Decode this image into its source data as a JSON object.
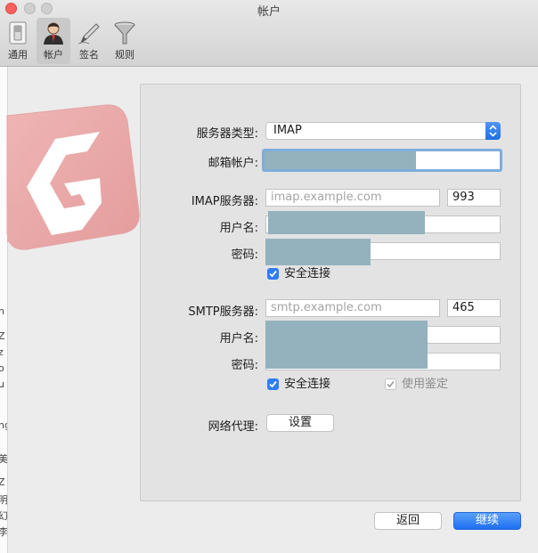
{
  "window": {
    "title": "帐户"
  },
  "toolbar": {
    "items": [
      {
        "label": "通用",
        "icon": "switch-icon"
      },
      {
        "label": "帐户",
        "icon": "user-icon",
        "active": true
      },
      {
        "label": "签名",
        "icon": "pen-icon"
      },
      {
        "label": "规则",
        "icon": "funnel-icon"
      }
    ]
  },
  "background_strip": {
    "fragments": [
      "h",
      "Z",
      "z",
      "o",
      "u",
      "ng",
      "美",
      "Z",
      "明",
      "幻",
      "李"
    ]
  },
  "form": {
    "server_type_label": "服务器类型:",
    "server_type_value": "IMAP",
    "email_label": "邮箱帐户:",
    "imap": {
      "server_label": "IMAP服务器:",
      "server_placeholder": "imap.example.com",
      "port": "993",
      "username_label": "用户名:",
      "password_label": "密码:",
      "ssl_label": "安全连接"
    },
    "smtp": {
      "server_label": "SMTP服务器:",
      "server_placeholder": "smtp.example.com",
      "port": "465",
      "username_label": "用户名:",
      "password_label": "密码:",
      "ssl_label": "安全连接",
      "auth_label": "使用鉴定"
    },
    "proxy_label": "网络代理:",
    "proxy_button": "设置"
  },
  "buttons": {
    "back": "返回",
    "continue": "继续"
  },
  "colors": {
    "accent": "#2f7cf6",
    "redaction": "#93b2bd",
    "logo": "#e8a8a8"
  }
}
